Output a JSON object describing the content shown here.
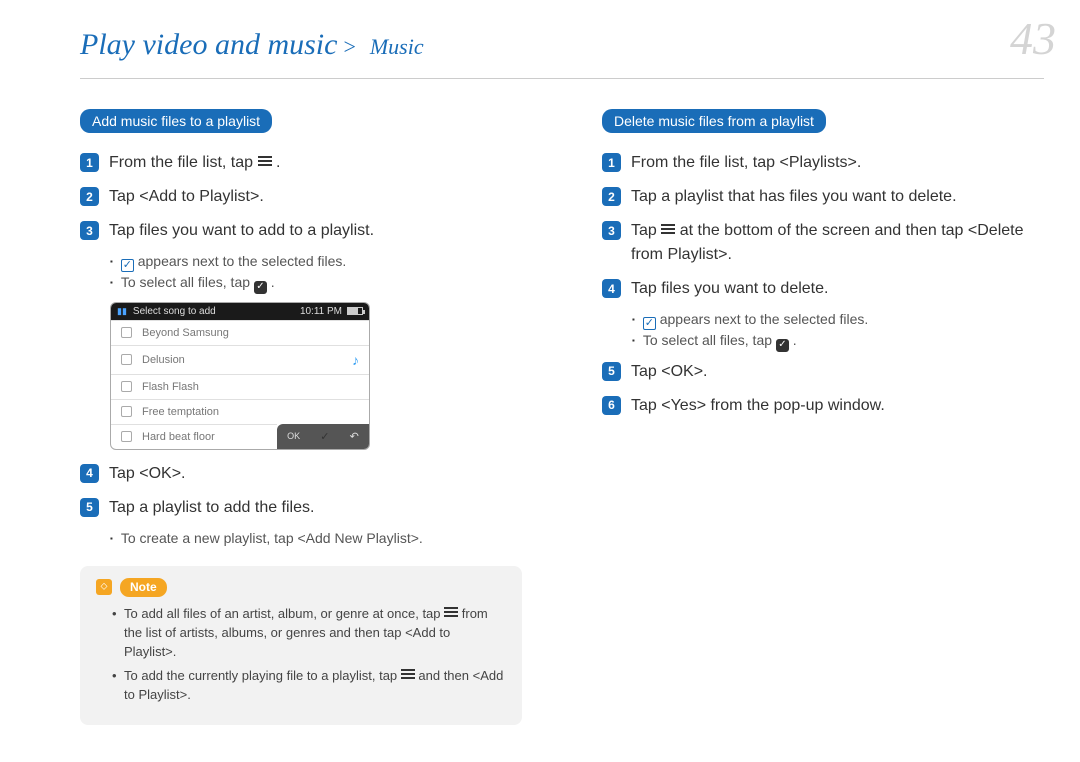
{
  "header": {
    "title": "Play video and music",
    "subsection": "Music",
    "separator": ">"
  },
  "page_number": "43",
  "left": {
    "pill": "Add music files to a playlist",
    "steps": {
      "s1_a": "From the file list, tap ",
      "s1_b": ".",
      "s2": "Tap <Add to Playlist>.",
      "s3": "Tap files you want to add to a playlist.",
      "s3_sub_a": " appears next to the selected files.",
      "s3_sub_b": "To select all files, tap ",
      "s3_sub_b_end": " .",
      "s4": "Tap <OK>.",
      "s5": "Tap a playlist to add the files.",
      "s5_sub": "To create a new playlist, tap <Add New Playlist>."
    },
    "device": {
      "bar_title": "Select song to add",
      "bar_time": "10:11 PM",
      "rows": [
        "Beyond Samsung",
        "Delusion",
        "Flash Flash",
        "Free temptation",
        "Hard beat floor"
      ],
      "ok": "OK"
    },
    "note": {
      "label": "Note",
      "items_a1": "To add all files of an artist, album, or genre at once, tap ",
      "items_a2": " from the list of artists, albums, or genres and then tap <Add to Playlist>.",
      "items_b1": "To add the currently playing file to a playlist, tap ",
      "items_b2": " and then <Add to Playlist>."
    }
  },
  "right": {
    "pill": "Delete music files from a playlist",
    "steps": {
      "s1": "From the file list, tap <Playlists>.",
      "s2": "Tap a playlist that has files you want to delete.",
      "s3_a": "Tap ",
      "s3_b": " at the bottom of the screen and then tap <Delete from Playlist>.",
      "s4": "Tap files you want to delete.",
      "s4_sub_a": " appears next to the selected files.",
      "s4_sub_b": "To select all files, tap ",
      "s4_sub_b_end": " .",
      "s5": "Tap <OK>.",
      "s6": "Tap <Yes> from the pop-up window."
    }
  }
}
